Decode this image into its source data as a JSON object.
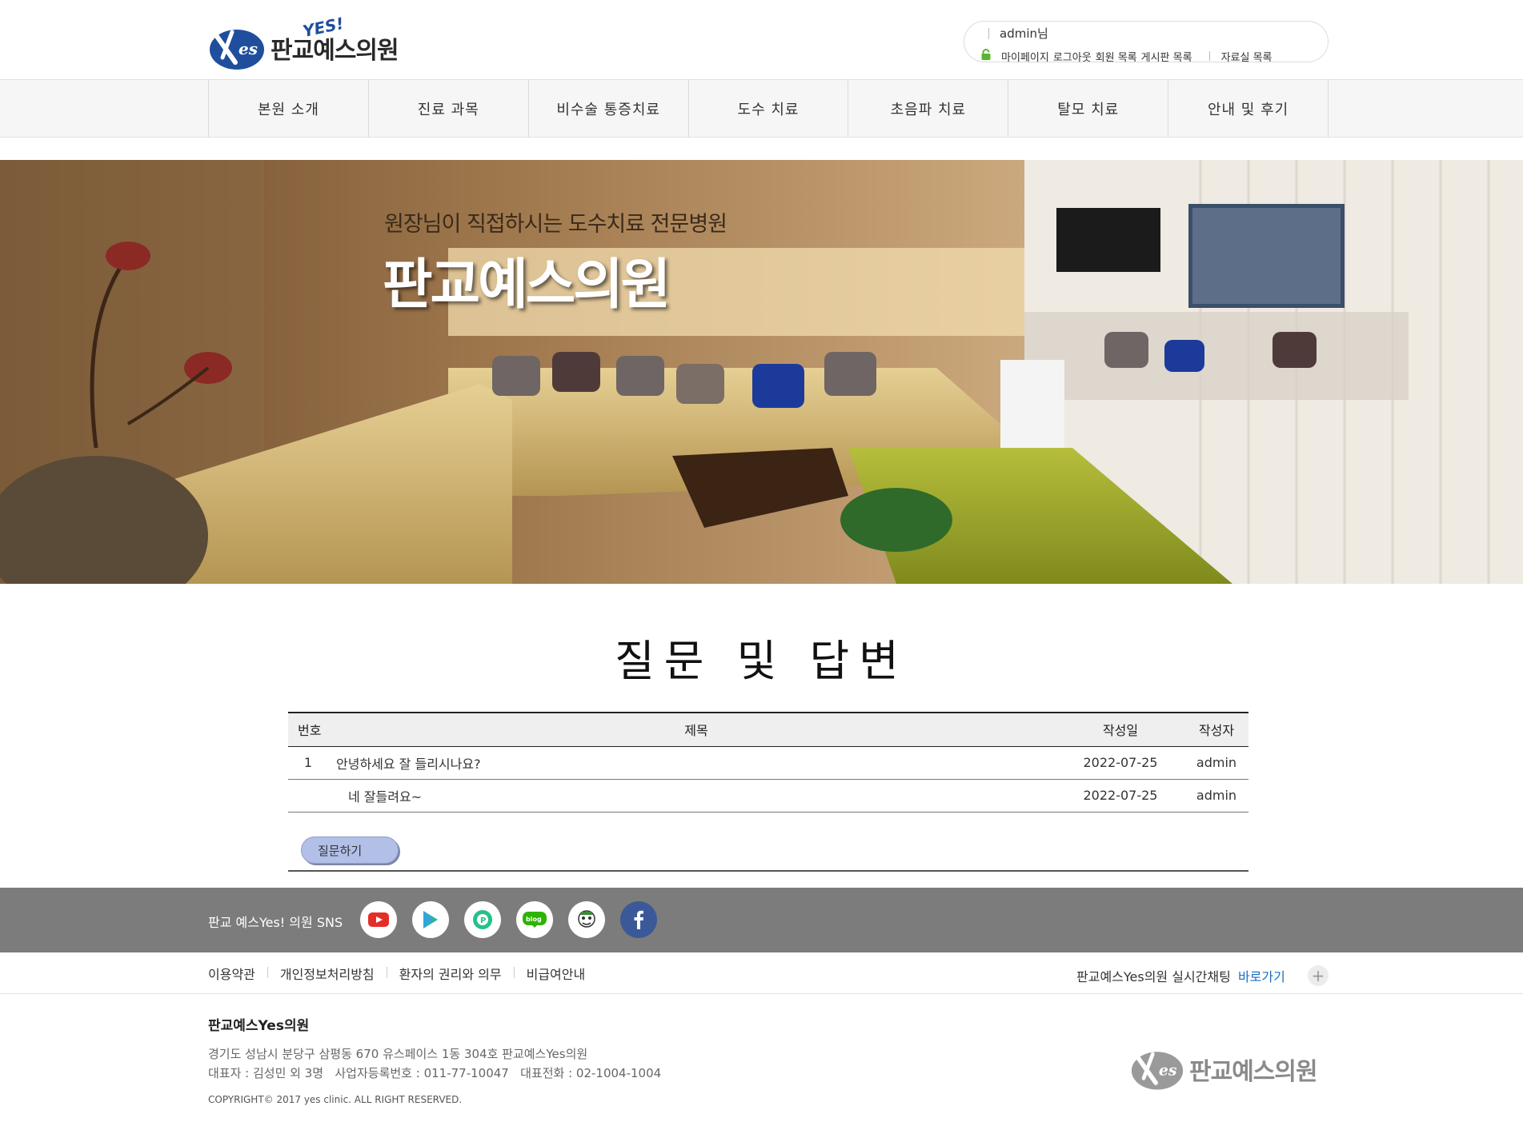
{
  "header": {
    "logo_text": "판교예스의원",
    "logo_badge": "YES!",
    "user_name": "admin님",
    "user_links": [
      "마이페이지",
      "로그아웃",
      "회원 목록",
      "게시판 목록",
      "자료실 목록"
    ]
  },
  "nav": {
    "items": [
      "본원 소개",
      "진료 과목",
      "비수술 통증치료",
      "도수 치료",
      "초음파 치료",
      "탈모 치료",
      "안내 및 후기"
    ]
  },
  "hero": {
    "subtitle": "원장님이 직접하시는 도수치료 전문병원",
    "title": "판교예스의원"
  },
  "board": {
    "page_title": "질문 및 답변",
    "columns": {
      "no": "번호",
      "title": "제목",
      "date": "작성일",
      "writer": "작성자"
    },
    "rows": [
      {
        "no": "1",
        "title": "안녕하세요 잘 들리시나요?",
        "date": "2022-07-25",
        "writer": "admin"
      },
      {
        "no": "",
        "title": "네 잘들려요~",
        "date": "2022-07-25",
        "writer": "admin"
      }
    ],
    "ask_button": "질문하기"
  },
  "sns": {
    "label": "판교 예스Yes! 의원 SNS",
    "icons": [
      "youtube-icon",
      "play-store-icon",
      "podcast-icon",
      "blog-icon",
      "character-icon",
      "facebook-icon"
    ]
  },
  "footer": {
    "links": [
      "이용약관",
      "개인정보처리방침",
      "환자의 권리와 의무",
      "비급여안내"
    ],
    "chat_label": "판교예스Yes의원 실시간채팅",
    "chat_link": "바로가기",
    "chat_plus": "+",
    "company": "판교예스Yes의원",
    "address": "경기도 성남시 분당구 삼평동 670 유스페이스 1동 304호 판교예스Yes의원",
    "ceo_line": "대표자 : 김성민 외 3명   사업자등록번호 : 011-77-10047   대표전화 : 02-1004-1004",
    "copyright": "COPYRIGHT© 2017 yes clinic. ALL RIGHT RESERVED.",
    "logo_text": "판교예스의원"
  },
  "colors": {
    "brand_blue": "#1f4f9c",
    "ask_button": "#b2c0e8",
    "sns_bar": "#7c7c7c",
    "link_blue": "#1a6fc0"
  }
}
